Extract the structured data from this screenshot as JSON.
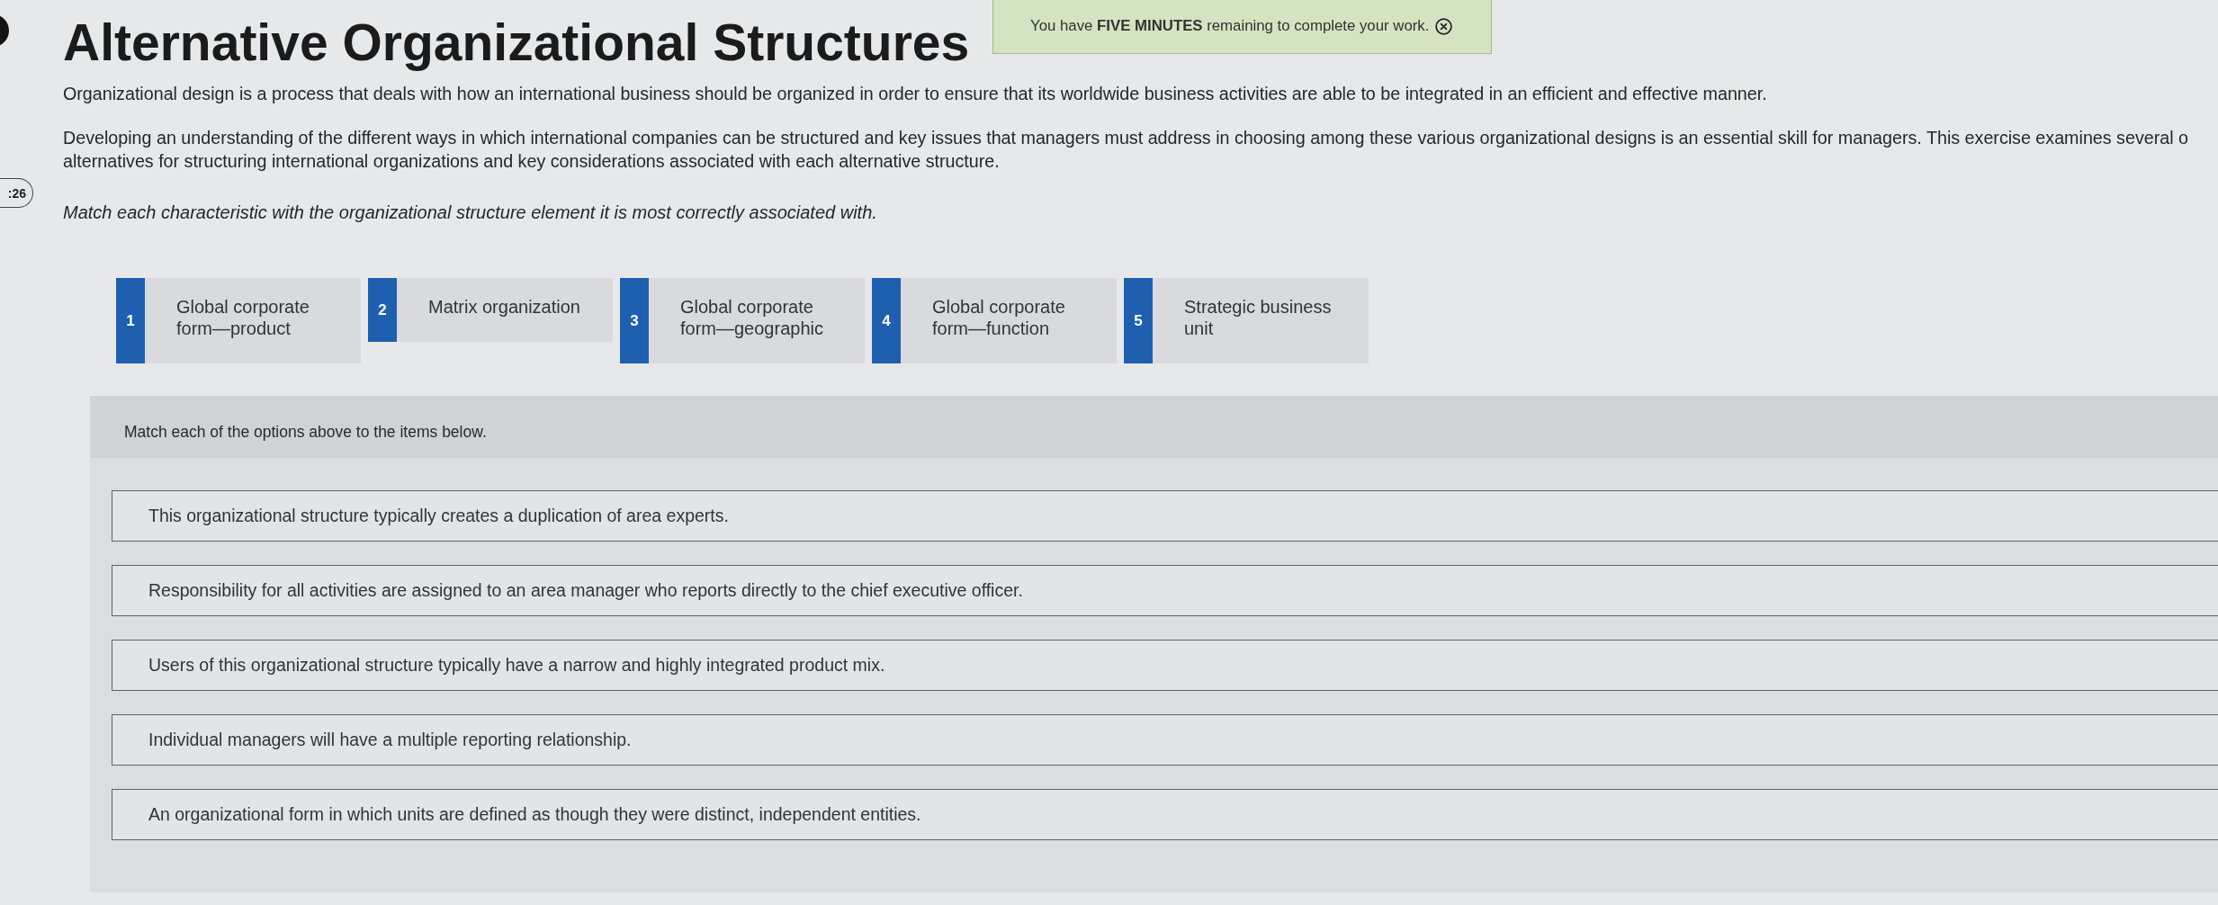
{
  "timer": ":26",
  "banner": {
    "text": "You have **FIVE MINUTES** remaining to complete your work."
  },
  "title": "Alternative Organizational Structures",
  "paragraphs": [
    {
      "lines": [
        "Organizational design is a process that deals with how an international business should be organized in order to ensure that its worldwide business activities are able to be integrated in an efficient and effective manner."
      ]
    },
    {
      "lines": [
        "Developing an understanding of the different ways in which international companies can be structured and key issues that managers must address in choosing among these various organizational designs is an essential skill for managers. This exercise examines several o",
        "alternatives for structuring international organizations and key considerations associated with each alternative structure."
      ]
    }
  ],
  "instruction": "Match each characteristic with the organizational structure element it is most correctly associated with.",
  "options": [
    {
      "number": "1",
      "label": "Global corporate form—product"
    },
    {
      "number": "2",
      "label": "Matrix organization"
    },
    {
      "number": "3",
      "label": "Global corporate form—geographic"
    },
    {
      "number": "4",
      "label": "Global corporate form—function"
    },
    {
      "number": "5",
      "label": "Strategic business unit"
    }
  ],
  "match_panel": {
    "heading": "Match each of the options above to the items below.",
    "items": [
      "This organizational structure typically creates a duplication of area experts.",
      "Responsibility for all activities are assigned to an area manager who reports directly to the chief executive officer.",
      "Users of this organizational structure typically have a narrow and highly integrated product mix.",
      "Individual managers will have a multiple reporting relationship.",
      "An organizational form in which units are defined as though they were distinct, independent entities."
    ]
  }
}
